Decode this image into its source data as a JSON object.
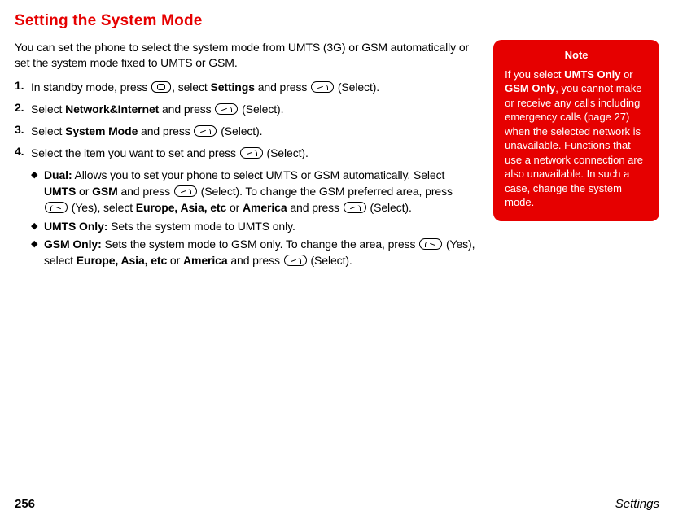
{
  "title": "Setting the System Mode",
  "intro": "You can set the phone to select the system mode from UMTS (3G) or GSM automatically or set the system mode fixed to UMTS or GSM.",
  "steps": [
    {
      "num": "1.",
      "pre": "In standby mode, press ",
      "btn1": "center",
      "mid1": ", select ",
      "bold1": "Settings",
      "mid2": " and press ",
      "btn2": "left",
      "post": " (Select)."
    },
    {
      "num": "2.",
      "pre": "Select ",
      "bold1": "Network&Internet",
      "mid1": " and press ",
      "btn1": "left",
      "post": " (Select)."
    },
    {
      "num": "3.",
      "pre": "Select ",
      "bold1": "System Mode",
      "mid1": " and press ",
      "btn1": "left",
      "post": " (Select)."
    },
    {
      "num": "4.",
      "pre": "Select the item you want to set and press ",
      "btn1": "left",
      "post": " (Select)."
    }
  ],
  "bullets": [
    {
      "bold": "Dual:",
      "t1": " Allows you to set your phone to select UMTS or GSM automatically. Select ",
      "b2": "UMTS",
      "t2": " or ",
      "b3": "GSM",
      "t3": " and press ",
      "btn1": "left",
      "t4": " (Select). To change the GSM preferred area, press ",
      "btn2": "right",
      "t5": " (Yes), select ",
      "b4": "Europe, Asia, etc",
      "t6": " or ",
      "b5": "America",
      "t7": " and press ",
      "btn3": "left",
      "t8": " (Select)."
    },
    {
      "bold": "UMTS Only:",
      "t1": " Sets the system mode to UMTS only."
    },
    {
      "bold": "GSM Only:",
      "t1": " Sets the system mode to GSM only. To change the area, press ",
      "btn1": "right",
      "t2": " (Yes), select ",
      "b2": "Europe, Asia, etc",
      "t3": " or ",
      "b3": "America",
      "t4": " and press ",
      "btn2": "left",
      "t5": " (Select)."
    }
  ],
  "note": {
    "title": "Note",
    "t1": "If you select ",
    "b1": "UMTS Only",
    "t2": " or ",
    "b2": "GSM Only",
    "t3": ", you cannot make or receive any calls including emergency calls (page 27) when the selected network is unavailable. Functions that use a network connection are also unavailable. In such a case, change the system mode."
  },
  "footer": {
    "page": "256",
    "section": "Settings"
  }
}
